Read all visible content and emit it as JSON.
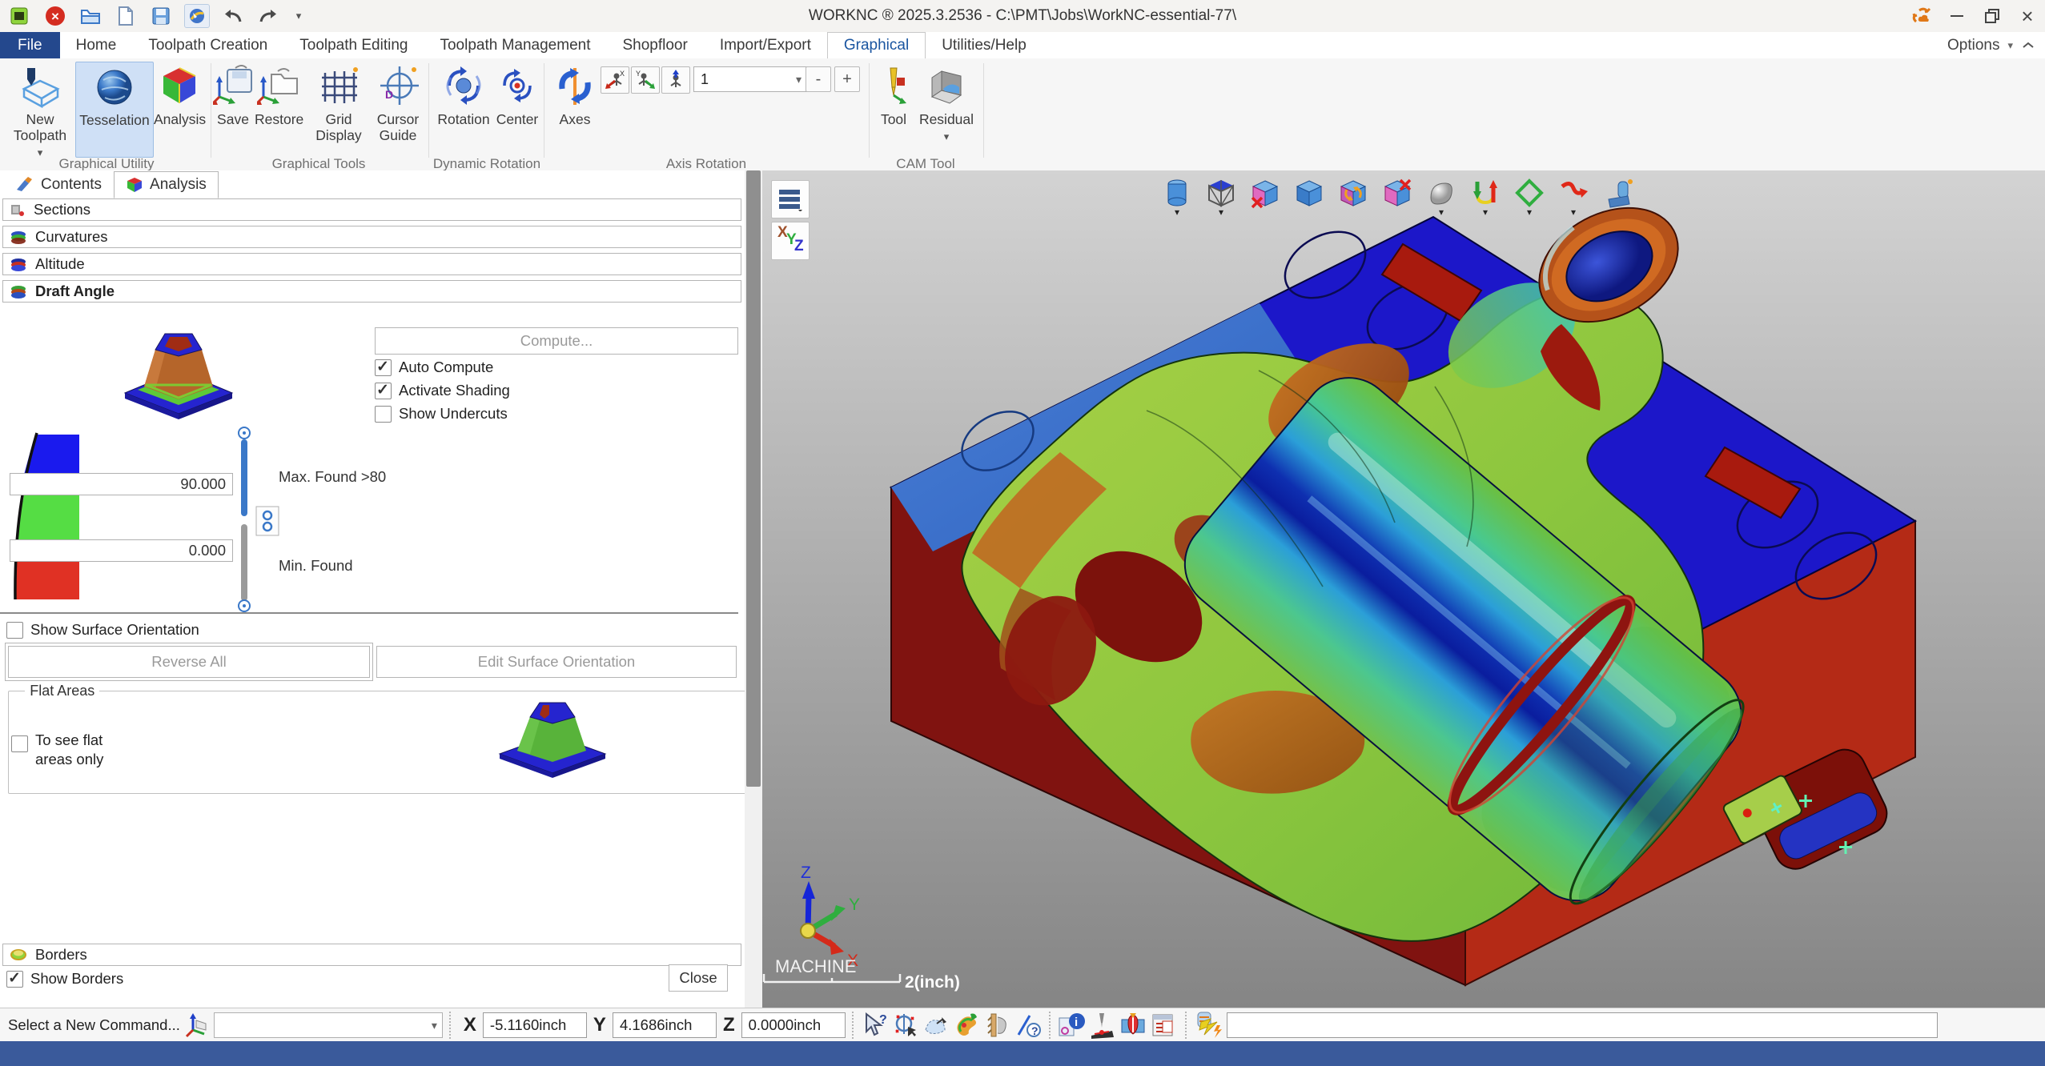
{
  "window": {
    "title": "WORKNC ® 2025.3.2536 - C:\\PMT\\Jobs\\WorkNC-essential-77\\",
    "options_label": "Options"
  },
  "menu": {
    "tabs": [
      "File",
      "Home",
      "Toolpath Creation",
      "Toolpath Editing",
      "Toolpath Management",
      "Shopfloor",
      "Import/Export",
      "Graphical",
      "Utilities/Help"
    ]
  },
  "ribbon": {
    "buttons": {
      "new_toolpath": "New Toolpath",
      "tesselation": "Tesselation",
      "analysis": "Analysis",
      "save": "Save",
      "restore": "Restore",
      "grid_display": "Grid Display",
      "cursor_guide": "Cursor Guide",
      "rotation": "Rotation",
      "center": "Center",
      "axes": "Axes",
      "tool": "Tool",
      "residual": "Residual"
    },
    "axis_step_value": "1",
    "minus": "-",
    "plus": "+",
    "group_labels": {
      "utility": "Graphical Utility",
      "tools": "Graphical Tools",
      "dynamic": "Dynamic Rotation",
      "axis": "Axis Rotation",
      "cam": "CAM Tool"
    }
  },
  "panel": {
    "tabs": {
      "contents": "Contents",
      "analysis": "Analysis"
    },
    "rows": {
      "sections": "Sections",
      "curvatures": "Curvatures",
      "altitude": "Altitude",
      "draft_angle": "Draft Angle",
      "borders": "Borders"
    },
    "draft": {
      "compute": "Compute...",
      "auto_compute": "Auto Compute",
      "activate_shading": "Activate Shading",
      "show_undercuts": "Show Undercuts",
      "max_value": "90.000",
      "min_value": "0.000",
      "max_found": "Max. Found >80",
      "min_found": "Min. Found",
      "show_surface_orientation": "Show Surface Orientation",
      "reverse_all": "Reverse All",
      "edit_surface_orientation": "Edit Surface Orientation",
      "flat_areas": "Flat Areas",
      "flat_only_line1": "To see flat",
      "flat_only_line2": "areas only",
      "show_borders": "Show Borders",
      "close": "Close"
    },
    "checkbox_states": {
      "auto_compute": true,
      "activate_shading": true,
      "show_undercuts": false,
      "show_surface_orientation": false,
      "to_see_flat_areas_only": false,
      "show_borders": true
    },
    "legend_colors": {
      "high": "#1a1aee",
      "mid": "#55dd44",
      "low": "#e03124"
    }
  },
  "viewport": {
    "machine_label": "MACHINE",
    "scale_label": "2(inch)",
    "axis_labels": {
      "x": "X",
      "y": "Y",
      "z": "Z"
    },
    "xyz_button": {
      "x": "X",
      "y": "Y",
      "z": "Z"
    }
  },
  "command_bar": {
    "prompt": "Select a New Command...",
    "command_value": "",
    "x_label": "X",
    "x_value": "-5.1160inch",
    "y_label": "Y",
    "y_value": "4.1686inch",
    "z_label": "Z",
    "z_value": "0.0000inch",
    "macro_value": ""
  },
  "colors": {
    "file_tab": "#24488d",
    "status_bar": "#3a5a9b",
    "tesselation_highlight": "#cfe0f6",
    "model_top": "#1c17c9",
    "model_left_face": "#801310",
    "model_right_face": "#b42a16",
    "model_chamfer": "#3f74c9"
  }
}
